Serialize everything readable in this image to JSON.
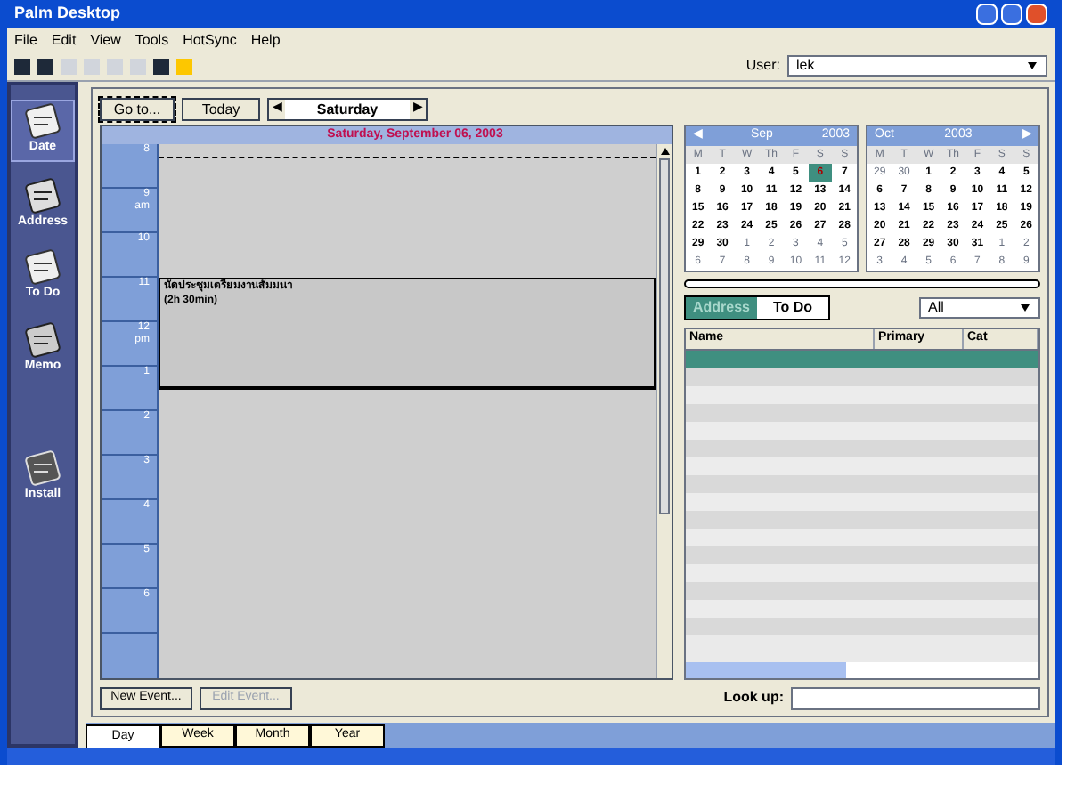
{
  "window": {
    "title": "Palm Desktop"
  },
  "menu": [
    "File",
    "Edit",
    "View",
    "Tools",
    "HotSync",
    "Help"
  ],
  "user": {
    "label": "User:",
    "value": "lek"
  },
  "sidebar": [
    {
      "label": "Date",
      "selected": true
    },
    {
      "label": "Address",
      "selected": false
    },
    {
      "label": "To Do",
      "selected": false
    },
    {
      "label": "Memo",
      "selected": false
    },
    {
      "label": "Install",
      "selected": false
    }
  ],
  "nav": {
    "goto": "Go to...",
    "today": "Today",
    "prev": "◀",
    "day": "Saturday",
    "next": "▶"
  },
  "date_heading": "Saturday, September 06, 2003",
  "slots": [
    {
      "time": "8"
    },
    {
      "time": "9",
      "sub": "am"
    },
    {
      "time": "10"
    },
    {
      "time": "11"
    },
    {
      "time": "12",
      "sub": "pm"
    },
    {
      "time": "1"
    },
    {
      "time": "2"
    },
    {
      "time": "3"
    },
    {
      "time": "4"
    },
    {
      "time": "5"
    },
    {
      "time": "6"
    }
  ],
  "event": {
    "title": "นัดประชุมเตรียมงานสัมมนา",
    "duration": "(2h 30min)"
  },
  "calendars": [
    {
      "prev": "◀",
      "month": "Sep",
      "year": "2003",
      "days": [
        "M",
        "T",
        "W",
        "Th",
        "F",
        "S",
        "S"
      ],
      "weeks": [
        [
          {
            "d": "1",
            "in_month": true,
            "selected": false
          },
          {
            "d": "2",
            "in_month": true,
            "selected": false
          },
          {
            "d": "3",
            "in_month": true,
            "selected": false
          },
          {
            "d": "4",
            "in_month": true,
            "selected": false
          },
          {
            "d": "5",
            "in_month": true,
            "selected": false
          },
          {
            "d": "6",
            "in_month": true,
            "selected": true
          },
          {
            "d": "7",
            "in_month": true,
            "selected": false
          }
        ],
        [
          {
            "d": "8",
            "in_month": true,
            "selected": false
          },
          {
            "d": "9",
            "in_month": true,
            "selected": false
          },
          {
            "d": "10",
            "in_month": true,
            "selected": false
          },
          {
            "d": "11",
            "in_month": true,
            "selected": false
          },
          {
            "d": "12",
            "in_month": true,
            "selected": false
          },
          {
            "d": "13",
            "in_month": true,
            "selected": false
          },
          {
            "d": "14",
            "in_month": true,
            "selected": false
          }
        ],
        [
          {
            "d": "15",
            "in_month": true,
            "selected": false
          },
          {
            "d": "16",
            "in_month": true,
            "selected": false
          },
          {
            "d": "17",
            "in_month": true,
            "selected": false
          },
          {
            "d": "18",
            "in_month": true,
            "selected": false
          },
          {
            "d": "19",
            "in_month": true,
            "selected": false
          },
          {
            "d": "20",
            "in_month": true,
            "selected": false
          },
          {
            "d": "21",
            "in_month": true,
            "selected": false
          }
        ],
        [
          {
            "d": "22",
            "in_month": true,
            "selected": false
          },
          {
            "d": "23",
            "in_month": true,
            "selected": false
          },
          {
            "d": "24",
            "in_month": true,
            "selected": false
          },
          {
            "d": "25",
            "in_month": true,
            "selected": false
          },
          {
            "d": "26",
            "in_month": true,
            "selected": false
          },
          {
            "d": "27",
            "in_month": true,
            "selected": false
          },
          {
            "d": "28",
            "in_month": true,
            "selected": false
          }
        ],
        [
          {
            "d": "29",
            "in_month": true,
            "selected": false
          },
          {
            "d": "30",
            "in_month": true,
            "selected": false
          },
          {
            "d": "1",
            "in_month": false,
            "selected": false
          },
          {
            "d": "2",
            "in_month": false,
            "selected": false
          },
          {
            "d": "3",
            "in_month": false,
            "selected": false
          },
          {
            "d": "4",
            "in_month": false,
            "selected": false
          },
          {
            "d": "5",
            "in_month": false,
            "selected": false
          }
        ],
        [
          {
            "d": "6",
            "in_month": false,
            "selected": false
          },
          {
            "d": "7",
            "in_month": false,
            "selected": false
          },
          {
            "d": "8",
            "in_month": false,
            "selected": false
          },
          {
            "d": "9",
            "in_month": false,
            "selected": false
          },
          {
            "d": "10",
            "in_month": false,
            "selected": false
          },
          {
            "d": "11",
            "in_month": false,
            "selected": false
          },
          {
            "d": "12",
            "in_month": false,
            "selected": false
          }
        ]
      ]
    },
    {
      "next": "▶",
      "month": "Oct",
      "year": "2003",
      "days": [
        "M",
        "T",
        "W",
        "Th",
        "F",
        "S",
        "S"
      ],
      "weeks": [
        [
          {
            "d": "29",
            "in_month": false,
            "selected": false
          },
          {
            "d": "30",
            "in_month": false,
            "selected": false
          },
          {
            "d": "1",
            "in_month": true,
            "selected": false
          },
          {
            "d": "2",
            "in_month": true,
            "selected": false
          },
          {
            "d": "3",
            "in_month": true,
            "selected": false
          },
          {
            "d": "4",
            "in_month": true,
            "selected": false
          },
          {
            "d": "5",
            "in_month": true,
            "selected": false
          }
        ],
        [
          {
            "d": "6",
            "in_month": true,
            "selected": false
          },
          {
            "d": "7",
            "in_month": true,
            "selected": false
          },
          {
            "d": "8",
            "in_month": true,
            "selected": false
          },
          {
            "d": "9",
            "in_month": true,
            "selected": false
          },
          {
            "d": "10",
            "in_month": true,
            "selected": false
          },
          {
            "d": "11",
            "in_month": true,
            "selected": false
          },
          {
            "d": "12",
            "in_month": true,
            "selected": false
          }
        ],
        [
          {
            "d": "13",
            "in_month": true,
            "selected": false
          },
          {
            "d": "14",
            "in_month": true,
            "selected": false
          },
          {
            "d": "15",
            "in_month": true,
            "selected": false
          },
          {
            "d": "16",
            "in_month": true,
            "selected": false
          },
          {
            "d": "17",
            "in_month": true,
            "selected": false
          },
          {
            "d": "18",
            "in_month": true,
            "selected": false
          },
          {
            "d": "19",
            "in_month": true,
            "selected": false
          }
        ],
        [
          {
            "d": "20",
            "in_month": true,
            "selected": false
          },
          {
            "d": "21",
            "in_month": true,
            "selected": false
          },
          {
            "d": "22",
            "in_month": true,
            "selected": false
          },
          {
            "d": "23",
            "in_month": true,
            "selected": false
          },
          {
            "d": "24",
            "in_month": true,
            "selected": false
          },
          {
            "d": "25",
            "in_month": true,
            "selected": false
          },
          {
            "d": "26",
            "in_month": true,
            "selected": false
          }
        ],
        [
          {
            "d": "27",
            "in_month": true,
            "selected": false
          },
          {
            "d": "28",
            "in_month": true,
            "selected": false
          },
          {
            "d": "29",
            "in_month": true,
            "selected": false
          },
          {
            "d": "30",
            "in_month": true,
            "selected": false
          },
          {
            "d": "31",
            "in_month": true,
            "selected": false
          },
          {
            "d": "1",
            "in_month": false,
            "selected": false
          },
          {
            "d": "2",
            "in_month": false,
            "selected": false
          }
        ],
        [
          {
            "d": "3",
            "in_month": false,
            "selected": false
          },
          {
            "d": "4",
            "in_month": false,
            "selected": false
          },
          {
            "d": "5",
            "in_month": false,
            "selected": false
          },
          {
            "d": "6",
            "in_month": false,
            "selected": false
          },
          {
            "d": "7",
            "in_month": false,
            "selected": false
          },
          {
            "d": "8",
            "in_month": false,
            "selected": false
          },
          {
            "d": "9",
            "in_month": false,
            "selected": false
          }
        ]
      ]
    }
  ],
  "list_tabs": [
    {
      "label": "Address",
      "selected": true
    },
    {
      "label": "To Do",
      "selected": false
    }
  ],
  "filter": "All",
  "table": {
    "columns": [
      "Name",
      "Primary",
      "Cat"
    ],
    "rows": [
      {
        "selected": true
      },
      {
        "selected": false
      },
      {
        "selected": false
      },
      {
        "selected": false
      },
      {
        "selected": false
      },
      {
        "selected": false
      },
      {
        "selected": false
      },
      {
        "selected": false
      },
      {
        "selected": false
      },
      {
        "selected": false
      },
      {
        "selected": false
      },
      {
        "selected": false
      },
      {
        "selected": false
      },
      {
        "selected": false
      },
      {
        "selected": false
      },
      {
        "selected": false
      }
    ]
  },
  "buttons": [
    {
      "label": "New Event...",
      "disabled": false
    },
    {
      "label": "Edit Event...",
      "disabled": true
    }
  ],
  "lookup": {
    "label": "Look up:"
  },
  "view_tabs": [
    {
      "label": "Day",
      "selected": true
    },
    {
      "label": "Week",
      "selected": false
    },
    {
      "label": "Month",
      "selected": false
    },
    {
      "label": "Year",
      "selected": false
    }
  ]
}
